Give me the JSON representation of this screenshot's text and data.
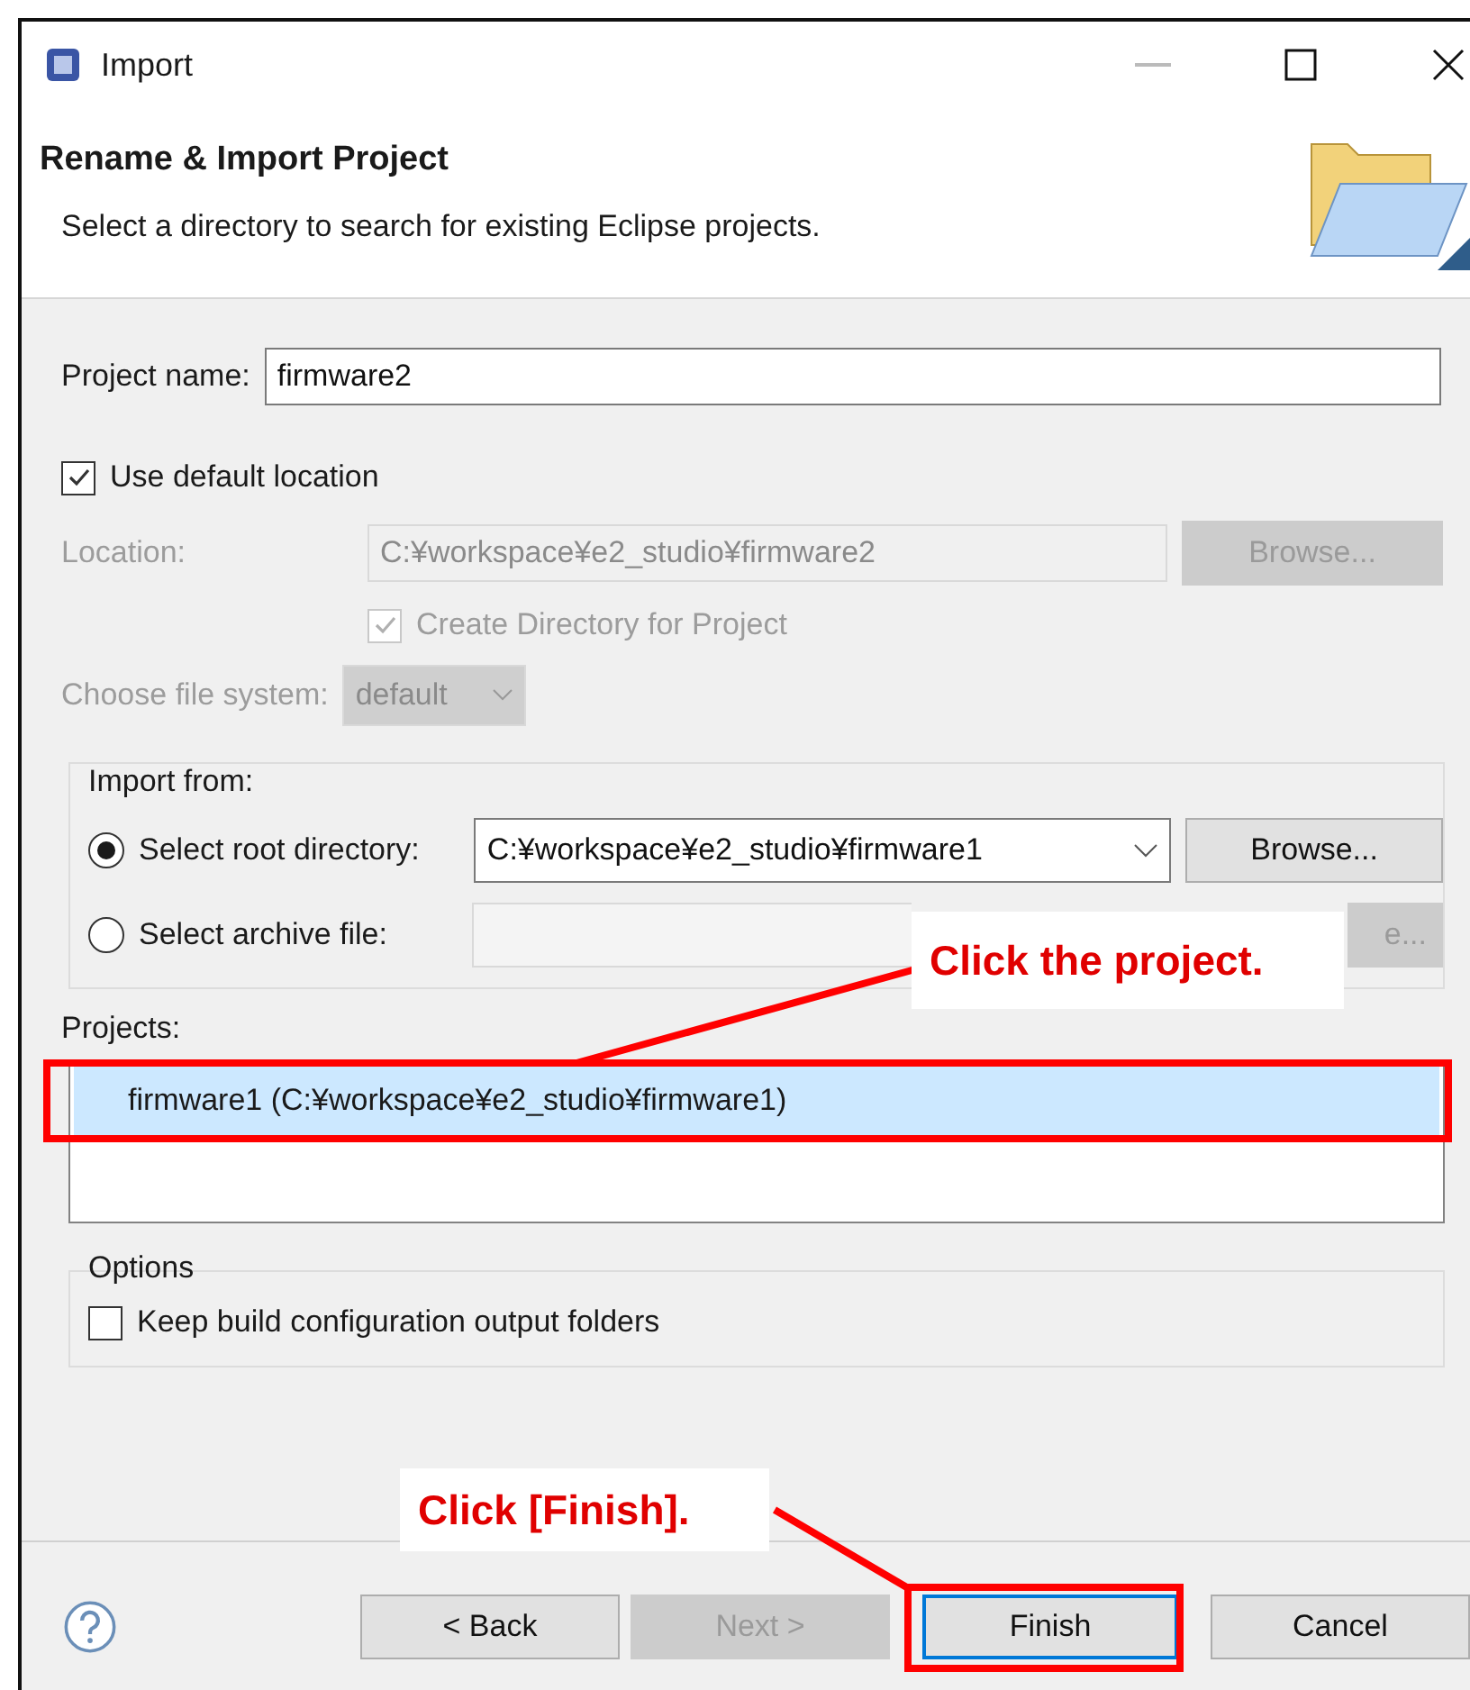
{
  "window": {
    "title": "Import"
  },
  "header": {
    "title": "Rename & Import Project",
    "description": "Select a directory to search for existing Eclipse projects."
  },
  "project_name": {
    "label": "Project name:",
    "value": "firmware2"
  },
  "use_default_location": {
    "label": "Use default location",
    "checked": true
  },
  "location": {
    "label": "Location:",
    "value": "C:¥workspace¥e2_studio¥firmware2",
    "button": "Browse...",
    "disabled": true
  },
  "create_directory": {
    "label": "Create Directory for Project",
    "checked": true,
    "disabled": true
  },
  "file_system": {
    "label": "Choose file system:",
    "value": "default",
    "disabled": true
  },
  "import_from": {
    "title": "Import from:",
    "options": [
      {
        "label": "Select root directory:",
        "selected": true,
        "value": "C:¥workspace¥e2_studio¥firmware1",
        "button": "Browse...",
        "button_disabled": false
      },
      {
        "label": "Select archive file:",
        "selected": false,
        "button": "e...",
        "button_disabled": true
      }
    ]
  },
  "projects": {
    "label": "Projects:",
    "items": [
      {
        "label": "firmware1 (C:¥workspace¥e2_studio¥firmware1)",
        "selected": true
      }
    ]
  },
  "options": {
    "title": "Options",
    "items": [
      {
        "label": "Keep build configuration output folders",
        "checked": false
      }
    ]
  },
  "buttons": [
    {
      "label": "< Back",
      "disabled": false,
      "default": false
    },
    {
      "label": "Next >",
      "disabled": true,
      "default": false
    },
    {
      "label": "Finish",
      "disabled": false,
      "default": true
    },
    {
      "label": "Cancel",
      "disabled": false,
      "default": false
    }
  ],
  "annotations": [
    {
      "text": "Click the project."
    },
    {
      "text": "Click [Finish]."
    }
  ]
}
